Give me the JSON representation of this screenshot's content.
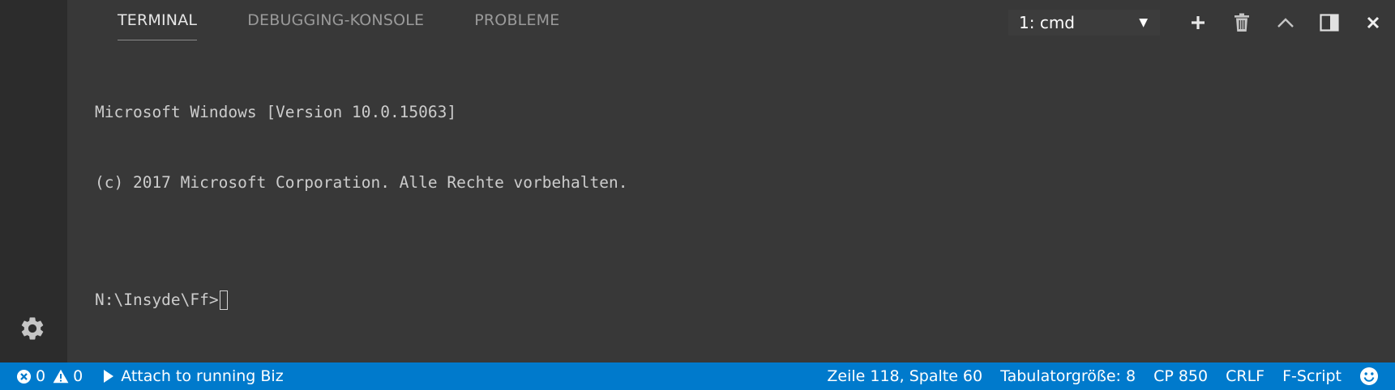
{
  "panel": {
    "tabs": [
      {
        "label": "TERMINAL",
        "active": true
      },
      {
        "label": "DEBUGGING-KONSOLE",
        "active": false
      },
      {
        "label": "PROBLEME",
        "active": false
      }
    ],
    "terminal_select": {
      "value": "1: cmd"
    }
  },
  "toolbar_icons": [
    "plus-icon",
    "trash-icon",
    "chevron-up-icon",
    "split-panel-icon",
    "close-icon"
  ],
  "terminal": {
    "lines": [
      "Microsoft Windows [Version 10.0.15063]",
      "(c) 2017 Microsoft Corporation. Alle Rechte vorbehalten.",
      ""
    ],
    "prompt": "N:\\Insyde\\Ff>"
  },
  "statusbar": {
    "errors": "0",
    "warnings": "0",
    "attach_label": "Attach to running Biz",
    "position": "Zeile 118, Spalte 60",
    "tab_size": "Tabulatorgröße: 8",
    "encoding": "CP 850",
    "eol": "CRLF",
    "language": "F-Script"
  },
  "colors": {
    "statusbar_bg": "#007acc",
    "panel_bg": "#383838",
    "activity_bar_bg": "#2c2c2c"
  }
}
